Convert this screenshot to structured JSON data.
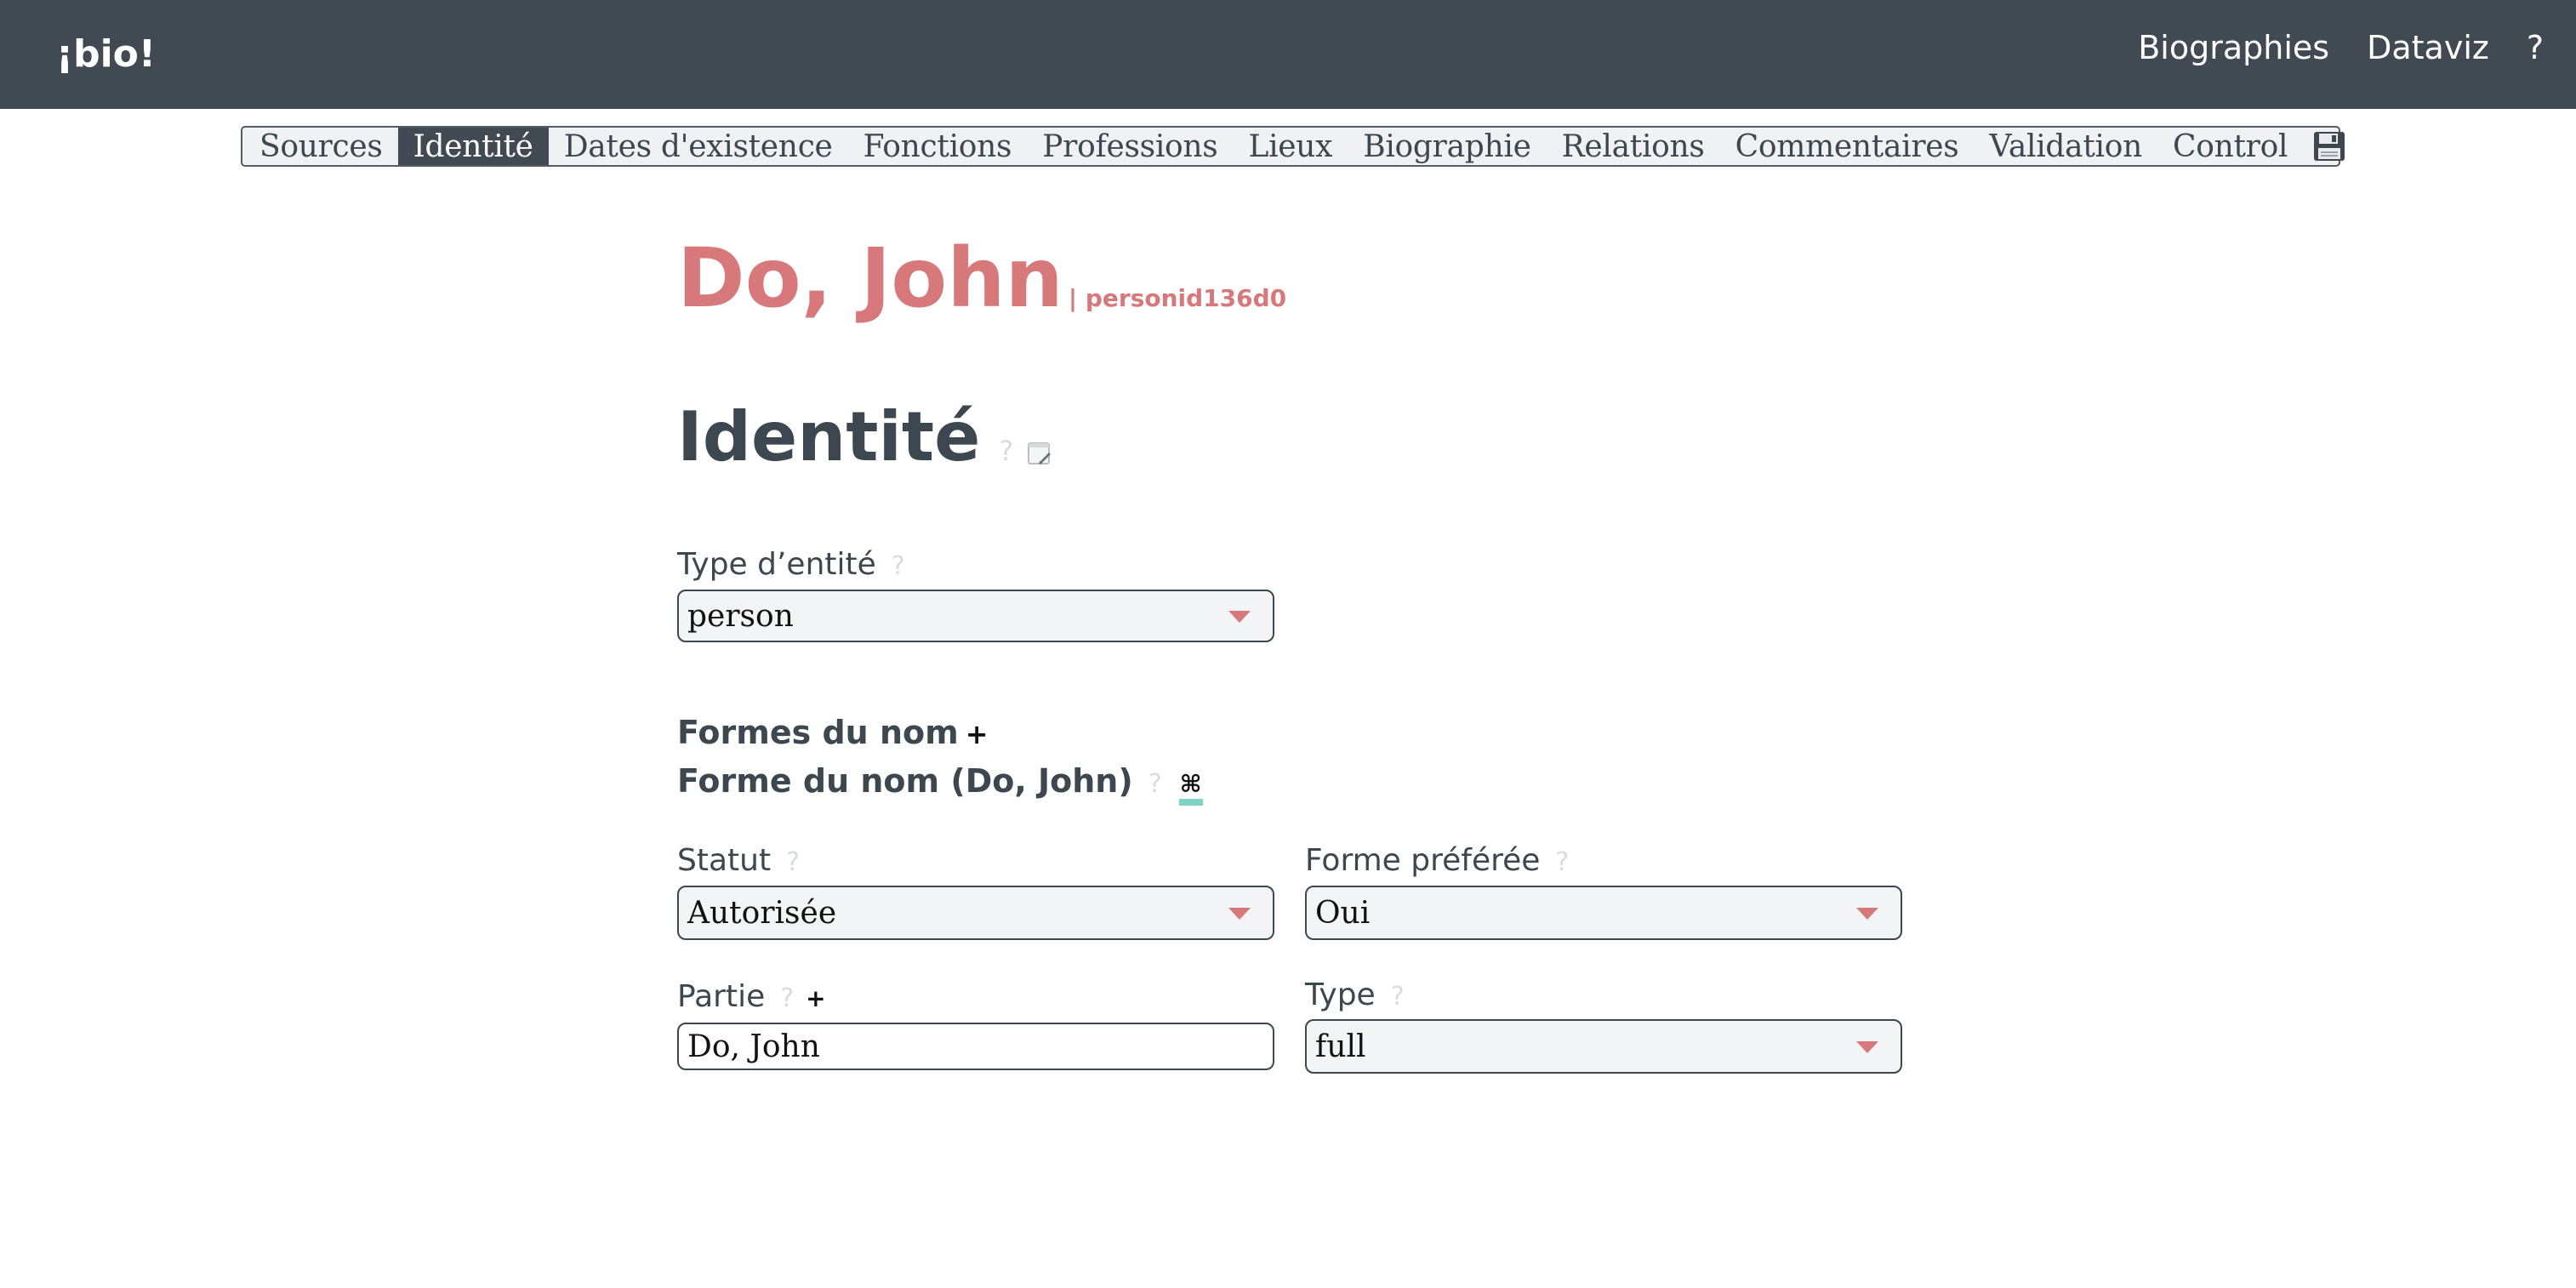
{
  "app": {
    "brand": "¡bio!",
    "nav": [
      "Biographies",
      "Dataviz",
      "?"
    ]
  },
  "tabs": [
    "Sources",
    "Identité",
    "Dates d'existence",
    "Fonctions",
    "Professions",
    "Lieux",
    "Biographie",
    "Relations",
    "Commentaires",
    "Validation",
    "Control"
  ],
  "active_tab": "Identité",
  "save_icon": "💾",
  "person": {
    "name": "Do, John",
    "id": "| personid136d0"
  },
  "section": {
    "title": "Identité",
    "help": "?",
    "note_icon": "notepad-icon"
  },
  "fields": {
    "entity_type": {
      "label": "Type d’entité",
      "help": "?",
      "value": "person"
    },
    "name_forms": {
      "label": "Formes du nom",
      "add": "+"
    },
    "name_form": {
      "label": "Forme du nom (Do, John)",
      "help": "?",
      "cmd": "⌘"
    },
    "status": {
      "label": "Statut",
      "help": "?",
      "value": "Autorisée"
    },
    "preferred": {
      "label": "Forme préférée",
      "help": "?",
      "value": "Oui"
    },
    "part": {
      "label": "Partie",
      "help": "?",
      "add": "+",
      "value": "Do, John"
    },
    "type": {
      "label": "Type",
      "help": "?",
      "value": "full"
    }
  },
  "colors": {
    "topbar": "#414a52",
    "accent": "#d7787a",
    "text": "#3c474f",
    "help": "#d9dcde",
    "cmd_bar": "#7fd3c4"
  }
}
